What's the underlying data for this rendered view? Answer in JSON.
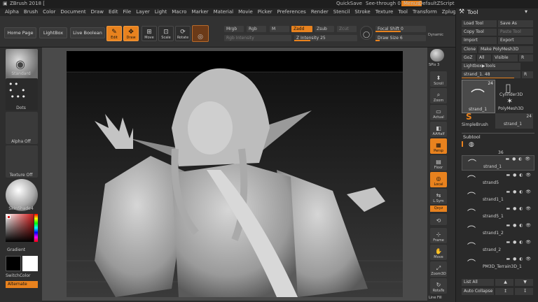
{
  "title_bar": {
    "app_title": "ZBrush 2018 [",
    "quicksave": "QuickSave",
    "see_through": "See-through",
    "see_through_value": "0",
    "menus": "Menus",
    "default_zscript": "DefaultZScript",
    "tool_title": "Tool"
  },
  "menu_bar": [
    "Alpha",
    "Brush",
    "Color",
    "Document",
    "Draw",
    "Edit",
    "File",
    "Layer",
    "Light",
    "Macro",
    "Marker",
    "Material",
    "Movie",
    "Picker",
    "Preferences",
    "Render",
    "Stencil",
    "Stroke",
    "Texture",
    "Tool",
    "Transform",
    "Zplugin",
    "Zscript"
  ],
  "toolbar": {
    "home_page": "Home Page",
    "lightbox": "LightBox",
    "live_boolean": "Live Boolean",
    "edit": "Edit",
    "draw": "Draw",
    "move": "Move",
    "scale": "Scale",
    "rotate": "Rotate",
    "mrgb": "Mrgb",
    "rgb": "Rgb",
    "m": "M",
    "zadd": "Zadd",
    "zsub": "Zsub",
    "zcut": "Zcut",
    "rgb_intensity": "Rgb Intensity",
    "z_intensity_label": "Z Intensity",
    "z_intensity_value": "25",
    "focal_shift_label": "Focal Shift",
    "focal_shift_value": "0",
    "draw_size_label": "Draw Size",
    "draw_size_value": "6",
    "dynamic": "Dynamic"
  },
  "left_shelf": {
    "standard": "Standard",
    "dots": "Dots",
    "alpha_off": "Alpha Off",
    "texture_off": "Texture Off",
    "skinshade": "SkinShade4",
    "gradient": "Gradient",
    "switchcolor": "SwitchColor",
    "alternate": "Alternate"
  },
  "right_shelf": {
    "spix_label": "SPix",
    "spix_value": "3",
    "scroll": "Scroll",
    "zoom": "Zoom",
    "actual": "Actual",
    "aahalf": "AAHalf",
    "persp": "Persp",
    "floor": "Floor",
    "local": "Local",
    "lsym": "L.Sym",
    "qxyz": "Qxyz",
    "frame": "Frame",
    "move": "Move",
    "zoom3d": "Zoom3D",
    "rotate": "RotaTe",
    "line_fill": "Line Fill"
  },
  "tool_panel": {
    "load_tool": "Load Tool",
    "save_as": "Save As",
    "copy_tool": "Copy Tool",
    "paste_tool": "Paste Tool",
    "import": "Import",
    "export": "Export",
    "clone": "Clone",
    "make_polymesh": "Make PolyMesh3D",
    "goz": "GoZ",
    "all": "All",
    "visible": "Visible",
    "r": "R",
    "lightbox_tools": "Lightbox▶Tools",
    "current_tool": "strand_1.",
    "current_tool_value": "48",
    "thumb_count": "24",
    "strand_1": "strand_1",
    "cylinder3d": "Cylinder3D",
    "polymesh3d": "PolyMesh3D",
    "simplebrush": "SimpleBrush",
    "strand_1b": "strand_1",
    "thumb_count2": "24",
    "subtool": "Subtool",
    "subtool_count": "36",
    "subtools": [
      "strand_1",
      "strand5",
      "strand1_1",
      "strand5_1",
      "strand1_2",
      "strand_2",
      "PM3D_Terrain3D_1"
    ],
    "list_all": "List All",
    "auto_collapse": "Auto Collapse"
  },
  "colors": {
    "accent": "#e8821e",
    "panel": "#2a2a2a",
    "canvas_bg": "#4a4a4a",
    "doc_bg": "#000000"
  }
}
